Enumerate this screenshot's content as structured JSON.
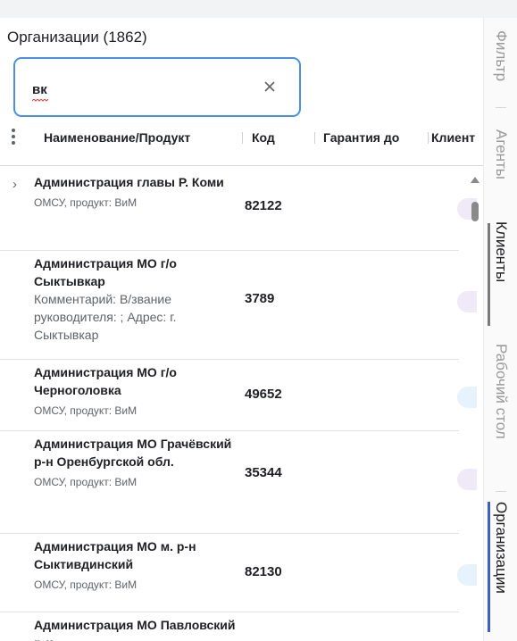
{
  "header": {
    "title": "Организации (1862)"
  },
  "search": {
    "value": "вк"
  },
  "columns": [
    {
      "label": "Наименование/Продукт"
    },
    {
      "label": "Код"
    },
    {
      "label": "Гарантия до"
    },
    {
      "label": "Клиент"
    }
  ],
  "rows": [
    {
      "name": "Администрация главы Р. Коми",
      "sub": "ОМСУ, продукт: ВиМ",
      "code": "82122"
    },
    {
      "name": "Администрация МО г/о Сыктывкар",
      "comment": "Комментарий: В/звание руководителя: ; Адрес: г. Сыктывкар",
      "code": "3789"
    },
    {
      "name": "Администрация МО г/о Черноголовка",
      "sub": "ОМСУ, продукт: ВиМ",
      "code": "49652"
    },
    {
      "name": "Администрация МО Грачёвский р-н Оренбургской обл.",
      "sub": "ОМСУ, продукт: ВиМ",
      "code": "35344"
    },
    {
      "name": "Администрация МО м. р-н Сыктивдинский",
      "sub": "ОМСУ, продукт: ВиМ",
      "code": "82130"
    },
    {
      "name": "Администрация МО Павловский р-н"
    }
  ],
  "side_tabs": [
    {
      "label": "Фильтр"
    },
    {
      "label": "Агенты"
    },
    {
      "label": "Клиенты"
    },
    {
      "label": "Рабочий стол"
    },
    {
      "label": "Организации"
    }
  ],
  "colors": {
    "accent": "#4a90e2",
    "chip_purple": "#efe9f8",
    "chip_blue": "#e6f2fc",
    "tab_indicator_blue": "#3d5fc8",
    "tab_indicator_gray": "#7a7a7a"
  }
}
